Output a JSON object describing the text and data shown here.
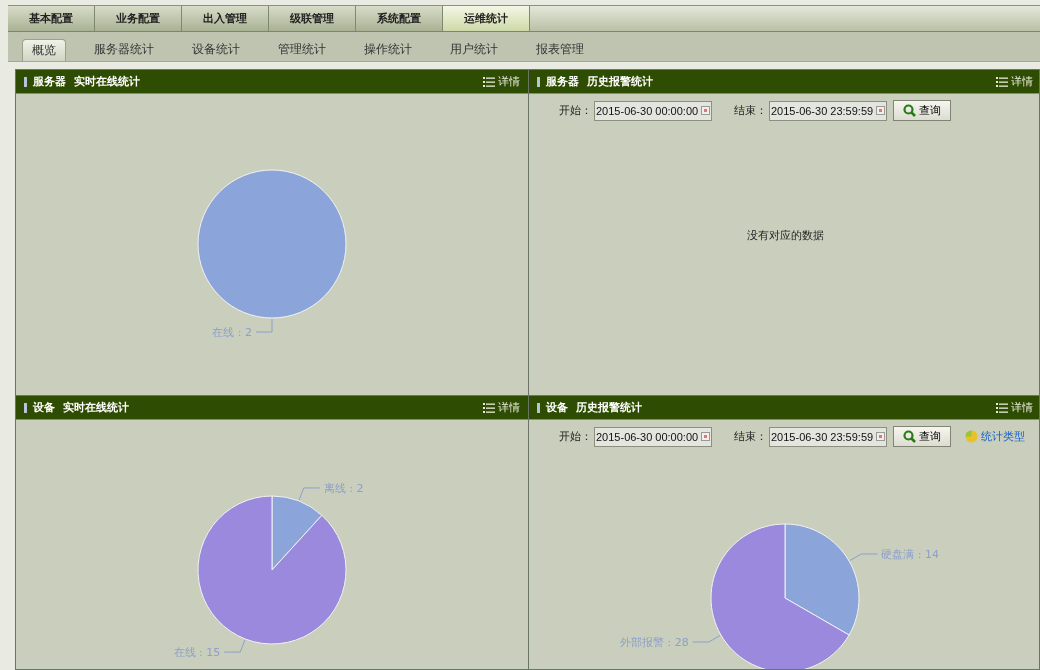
{
  "main_tabs": [
    {
      "label": "基本配置",
      "selected": false
    },
    {
      "label": "业务配置",
      "selected": false
    },
    {
      "label": "出入管理",
      "selected": false
    },
    {
      "label": "级联管理",
      "selected": false
    },
    {
      "label": "系统配置",
      "selected": false
    },
    {
      "label": "运维统计",
      "selected": true
    }
  ],
  "sub_tabs": [
    {
      "label": "概览",
      "selected": true
    },
    {
      "label": "服务器统计",
      "selected": false
    },
    {
      "label": "设备统计",
      "selected": false
    },
    {
      "label": "管理统计",
      "selected": false
    },
    {
      "label": "操作统计",
      "selected": false
    },
    {
      "label": "用户统计",
      "selected": false
    },
    {
      "label": "报表管理",
      "selected": false
    }
  ],
  "panels": [
    {
      "title": "服务器  实时在线统计",
      "detail": "详情",
      "chart_data": {
        "type": "pie",
        "values": [
          2
        ],
        "value_labels": [
          "在线 : 2"
        ]
      }
    },
    {
      "title": "服务器  历史报警统计",
      "detail": "详情",
      "query": {
        "start_label": "开始：",
        "start_value": "2015-06-30 00:00:00",
        "end_label": "结束：",
        "end_value": "2015-06-30 23:59:59",
        "button": "查询"
      },
      "empty_message": "没有对应的数据"
    },
    {
      "title": "设备  实时在线统计",
      "detail": "详情",
      "chart_data": {
        "type": "pie",
        "values": [
          2,
          15
        ],
        "value_labels": [
          "离线 : 2",
          "在线 : 15"
        ]
      }
    },
    {
      "title": "设备  历史报警统计",
      "detail": "详情",
      "query": {
        "start_label": "开始：",
        "start_value": "2015-06-30 00:00:00",
        "end_label": "结束：",
        "end_value": "2015-06-30 23:59:59",
        "button": "查询",
        "type_link": "统计类型"
      },
      "chart_data": {
        "type": "pie",
        "values": [
          14,
          28
        ],
        "value_labels": [
          "硬盘满 : 14",
          "外部报警 : 28"
        ]
      }
    }
  ]
}
